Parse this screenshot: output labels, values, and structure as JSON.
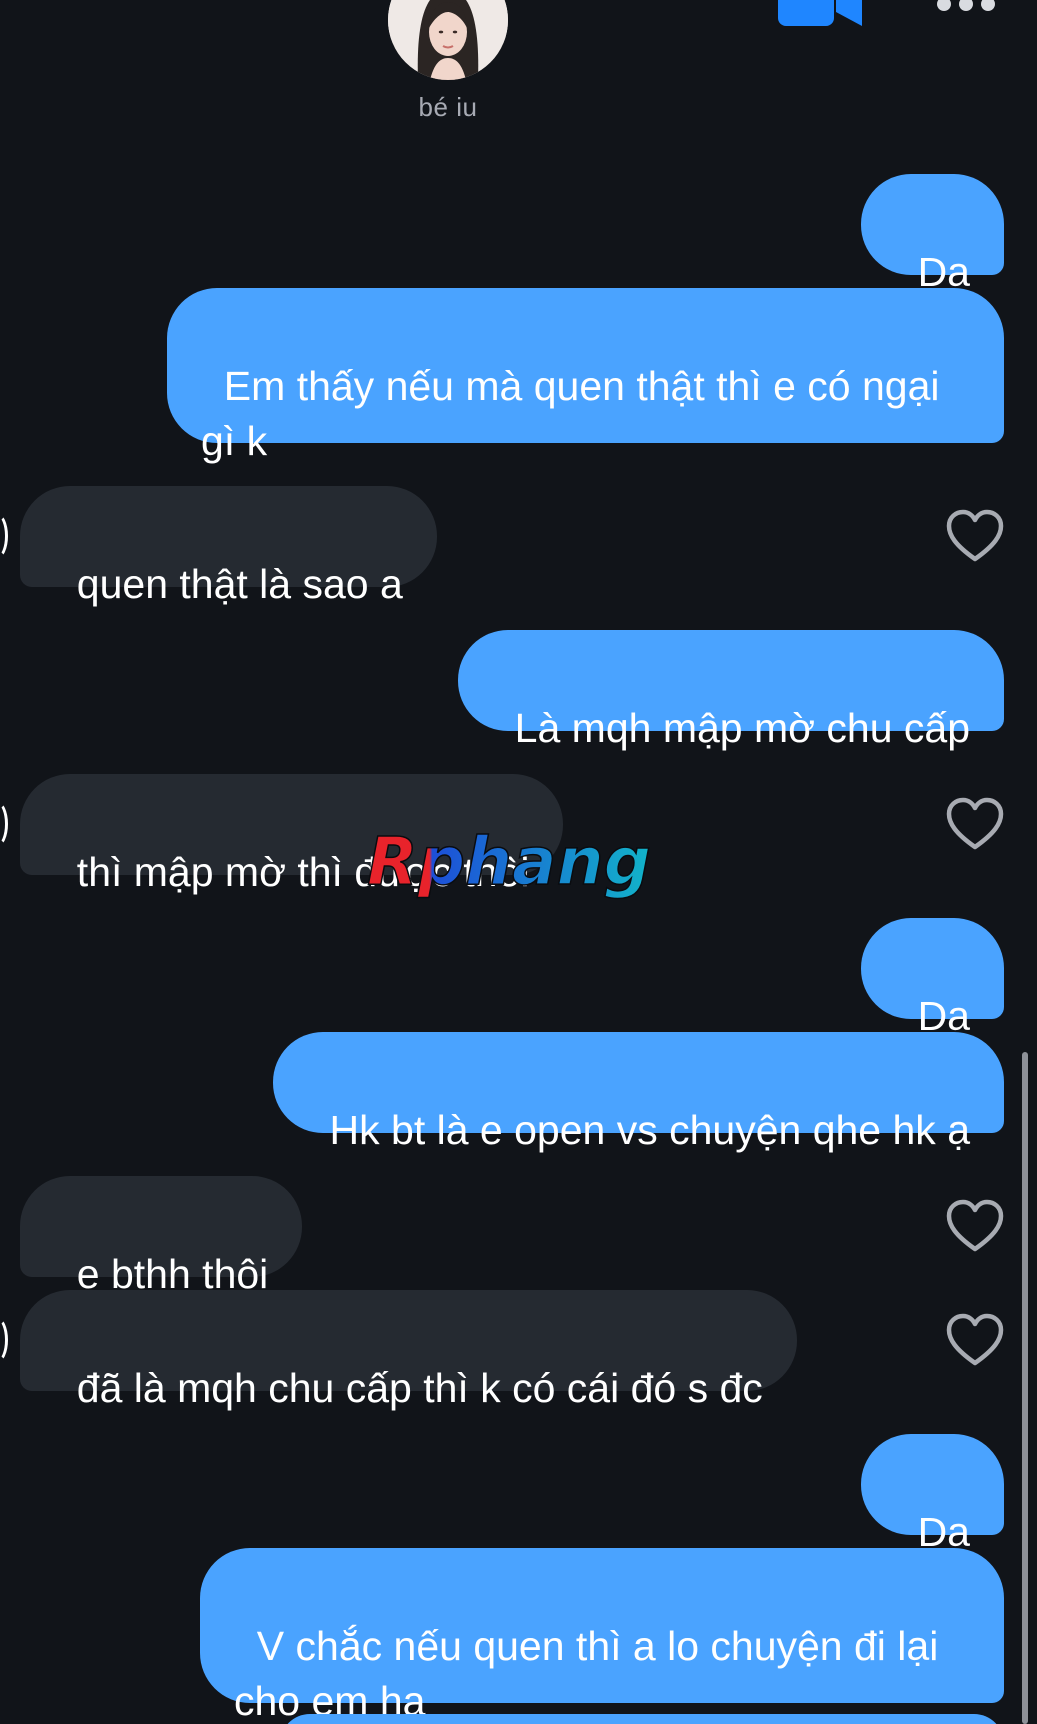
{
  "contact": {
    "name": "bé iu",
    "avatar_icon": "profile-photo"
  },
  "header_icons": {
    "video": "video-camera-icon",
    "more": "more-icon"
  },
  "messages": [
    {
      "side": "sent",
      "text": "Dạ"
    },
    {
      "side": "sent",
      "text": "Em thấy nếu mà quen thật thì e có ngại\ngì k"
    },
    {
      "side": "received",
      "text": "quen thật là sao a"
    },
    {
      "side": "sent",
      "text": "Là mqh mập mờ chu cấp"
    },
    {
      "side": "received",
      "text": "thì mập mờ thì được thôi"
    },
    {
      "side": "sent",
      "text": "Dạ"
    },
    {
      "side": "sent",
      "text": "Hk bt là e open vs chuyện qhe hk ạ"
    },
    {
      "side": "received",
      "text": "e bthh thôi"
    },
    {
      "side": "received",
      "text": "đã là mqh chu cấp thì k có cái đó s đc"
    },
    {
      "side": "sent",
      "text": "Dạ"
    },
    {
      "side": "sent",
      "text": "V chắc nếu quen thì a lo chuyện đi lại\ncho em ha"
    }
  ],
  "watermark": {
    "text": "Rphang"
  },
  "colors": {
    "background": "#111419",
    "sent_bubble": "#4aa3ff",
    "received_bubble": "#252a31",
    "video_icon": "#1f86ff",
    "heart": "#a8abb2"
  }
}
